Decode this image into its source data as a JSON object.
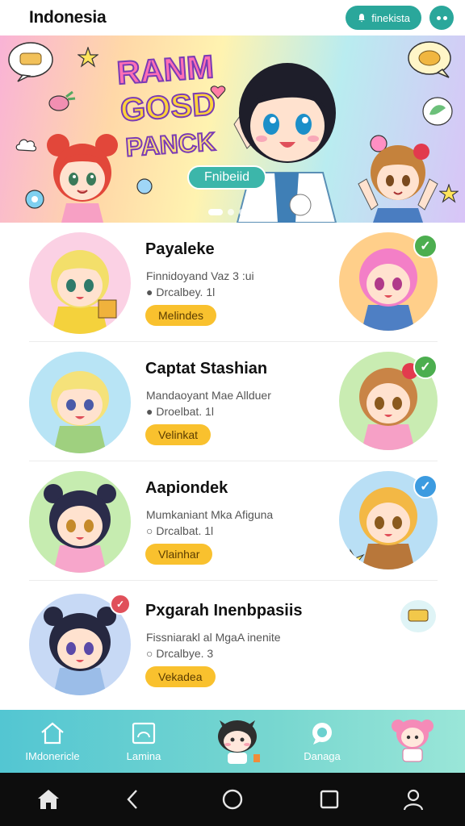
{
  "header": {
    "title": "Indonesia",
    "action_label": "finekista"
  },
  "banner": {
    "title_line1": "RANM",
    "title_line2": "GOSD",
    "title_line3": "PANCK",
    "cta_label": "Fnibeiid",
    "slide_count": 4,
    "active_slide": 0
  },
  "cards": [
    {
      "name": "Payaleke",
      "desc": "Finnidoyand Vaz 3 :ui",
      "meta": "Drcalbey. 1l",
      "tag": "Melindes",
      "avatar_hair": "#f3df6a",
      "avatar_bg": "#fbd1e4",
      "side_hair": "#f37fc7",
      "side_bg": "#ffcf8a",
      "check_color": "#4cae4f"
    },
    {
      "name": "Captat Stashian",
      "desc": "Mandaoyant Mae Allduer",
      "meta": "Droelbat. 1l",
      "tag": "Velinkat",
      "avatar_hair": "#f5e27a",
      "avatar_bg": "#b8e4f5",
      "side_hair": "#c98446",
      "side_bg": "#c9ecb2",
      "check_color": "#4cae4f"
    },
    {
      "name": "Aapiondek",
      "desc": "Mumkaniant Mka Afiguna",
      "meta": "Drcalbat. 1l",
      "tag": "Vlainhar",
      "avatar_hair": "#2b2c4a",
      "avatar_bg": "#c6ecb0",
      "side_hair": "#f3b845",
      "side_bg": "#b9dff5",
      "check_color": "#3c9be0"
    },
    {
      "name": "Pxgarah Inenbpasiis",
      "desc": "Fissniarakl al MgaA inenite",
      "meta": "Drcalbye. 3",
      "tag": "Vekadea",
      "avatar_hair": "#262840",
      "avatar_bg": "#c7d9f5",
      "side_hair": "#f2d05a",
      "side_bg": "#cfeff5",
      "check_color": "#e0505a"
    }
  ],
  "bottom_nav": [
    {
      "label": "IMdonericle",
      "icon": "home-outline-icon"
    },
    {
      "label": "Lamina",
      "icon": "picture-frame-icon"
    },
    {
      "label": "",
      "icon": "cat-mascot-icon"
    },
    {
      "label": "Danaga",
      "icon": "chat-bubble-icon"
    },
    {
      "label": "",
      "icon": "girl-mascot-icon"
    }
  ],
  "system_nav": [
    "home-icon",
    "back-icon",
    "circle-home-icon",
    "recents-icon",
    "profile-icon"
  ],
  "colors": {
    "accent": "#2aa79b",
    "tag": "#f9c12e",
    "nav_start": "#53c6d2",
    "nav_end": "#9ae6d8"
  }
}
